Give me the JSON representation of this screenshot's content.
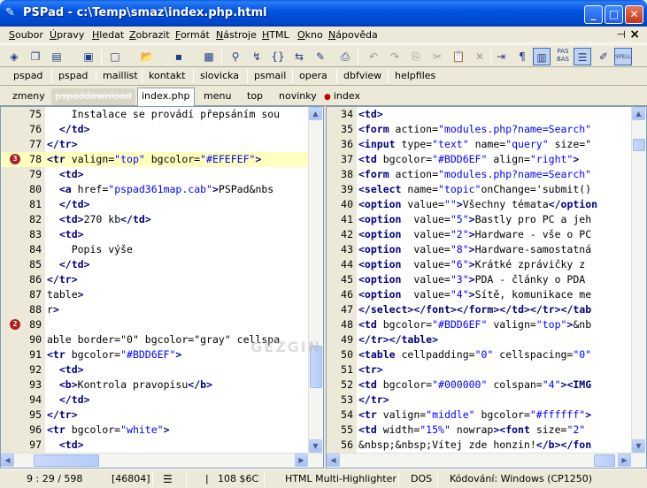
{
  "window": {
    "title": "PSPad - c:\\Temp\\smaz\\index.php.html"
  },
  "menubar": {
    "items": [
      {
        "label": "Soubor",
        "u": "S",
        "rest": "oubor"
      },
      {
        "label": "Úpravy",
        "u": "Ú",
        "rest": "pravy"
      },
      {
        "label": "Hledat",
        "u": "H",
        "rest": "ledat"
      },
      {
        "label": "Zobrazit",
        "u": "Z",
        "rest": "obrazit"
      },
      {
        "label": "Formát",
        "u": "F",
        "rest": "ormát"
      },
      {
        "label": "Nástroje",
        "u": "N",
        "rest": "ástroje"
      },
      {
        "label": "HTML",
        "u": "H",
        "rest": "TML"
      },
      {
        "label": "Okno",
        "u": "O",
        "rest": "kno"
      },
      {
        "label": "Nápověda",
        "u": "N",
        "rest": "ápověda"
      }
    ]
  },
  "bookmark_bar": {
    "items": [
      "pspad",
      "pspad",
      "maillist",
      "kontakt",
      "slovicka",
      "psmail",
      "opera",
      "dbfview",
      "helpfiles"
    ]
  },
  "tabs": {
    "items": [
      "zmeny",
      "pspaddownload",
      "index.php",
      "menu",
      "top",
      "novinky",
      "index"
    ]
  },
  "left_editor": {
    "lines": [
      {
        "n": "75",
        "html": "    Instalace se provádí přepsáním sou"
      },
      {
        "n": "76",
        "html": "  </td>"
      },
      {
        "n": "77",
        "html": "</tr>"
      },
      {
        "n": "78",
        "html": "<tr valign=\"top\" bgcolor=\"#EFEFEF\">"
      },
      {
        "n": "79",
        "html": "  <td>"
      },
      {
        "n": "80",
        "html": "  <a href=\"pspad361map.cab\">PSPad&nbs"
      },
      {
        "n": "81",
        "html": "  </td>"
      },
      {
        "n": "82",
        "html": "  <td>270 kb</td>"
      },
      {
        "n": "83",
        "html": "  <td>"
      },
      {
        "n": "84",
        "html": "    Popis výše"
      },
      {
        "n": "85",
        "html": "  </td>"
      },
      {
        "n": "86",
        "html": "</tr>"
      },
      {
        "n": "87",
        "html": "table>"
      },
      {
        "n": "88",
        "html": "r>"
      },
      {
        "n": "89",
        "html": ""
      },
      {
        "n": "90",
        "html": "able border=\"0\" bgcolor=\"gray\" cellspa"
      },
      {
        "n": "91",
        "html": "<tr bgcolor=\"#BDD6EF\">"
      },
      {
        "n": "92",
        "html": "  <td>"
      },
      {
        "n": "93",
        "html": "  <b>Kontrola pravopisu</b>"
      },
      {
        "n": "94",
        "html": "  </td>"
      },
      {
        "n": "95",
        "html": "</tr>"
      },
      {
        "n": "96",
        "html": "<tr bgcolor=\"white\">"
      },
      {
        "n": "97",
        "html": "  <td>"
      }
    ],
    "bookmarks": [
      {
        "line": "78",
        "label": "3"
      },
      {
        "line": "89",
        "label": "2"
      }
    ],
    "highlight_line": "78"
  },
  "right_editor": {
    "lines": [
      {
        "n": "34",
        "html": "<td>"
      },
      {
        "n": "35",
        "html": "<form action=\"modules.php?name=Search\""
      },
      {
        "n": "36",
        "html": "<input type=\"text\" name=\"query\" size=\""
      },
      {
        "n": "37",
        "html": "<td bgcolor=\"#BDD6EF\" align=\"right\">"
      },
      {
        "n": "38",
        "html": "<form action=\"modules.php?name=Search\""
      },
      {
        "n": "39",
        "html": "<select name=\"topic\"onChange='submit()"
      },
      {
        "n": "40",
        "html": "<option value=\"\">Všechny témata</option"
      },
      {
        "n": "41",
        "html": "<option  value=\"5\">Bastly pro PC a jeh"
      },
      {
        "n": "42",
        "html": "<option  value=\"2\">Hardware - vše o PC"
      },
      {
        "n": "43",
        "html": "<option  value=\"8\">Hardware-samostatná"
      },
      {
        "n": "44",
        "html": "<option  value=\"6\">Krátké zprávičky z"
      },
      {
        "n": "45",
        "html": "<option  value=\"3\">PDA - články o PDA"
      },
      {
        "n": "46",
        "html": "<option  value=\"4\">Sítě, komunikace me"
      },
      {
        "n": "47",
        "html": "</select></font></form></td></tr></tab"
      },
      {
        "n": "48",
        "html": "<td bgcolor=\"#BDD6EF\" valign=\"top\">&nb"
      },
      {
        "n": "49",
        "html": "</tr></table>"
      },
      {
        "n": "50",
        "html": "<table cellpadding=\"0\" cellspacing=\"0\""
      },
      {
        "n": "51",
        "html": "<tr>"
      },
      {
        "n": "52",
        "html": "<td bgcolor=\"#000000\" colspan=\"4\"><IMG"
      },
      {
        "n": "53",
        "html": "</tr>"
      },
      {
        "n": "54",
        "html": "<tr valign=\"middle\" bgcolor=\"#ffffff\">"
      },
      {
        "n": "55",
        "html": "<td width=\"15%\" nowrap><font size=\"2\""
      },
      {
        "n": "56",
        "html": "&nbsp;&nbsp;Vítej zde honzin!</b></fon"
      }
    ]
  },
  "status": {
    "position": "9 : 29 / 598",
    "offset": "[46804]",
    "char": "108  $6C",
    "highlighter": "HTML Multi-Highlighter",
    "eol": "DOS",
    "encoding": "Kódování: Windows (CP1250)"
  },
  "watermark": "GEZGIN"
}
